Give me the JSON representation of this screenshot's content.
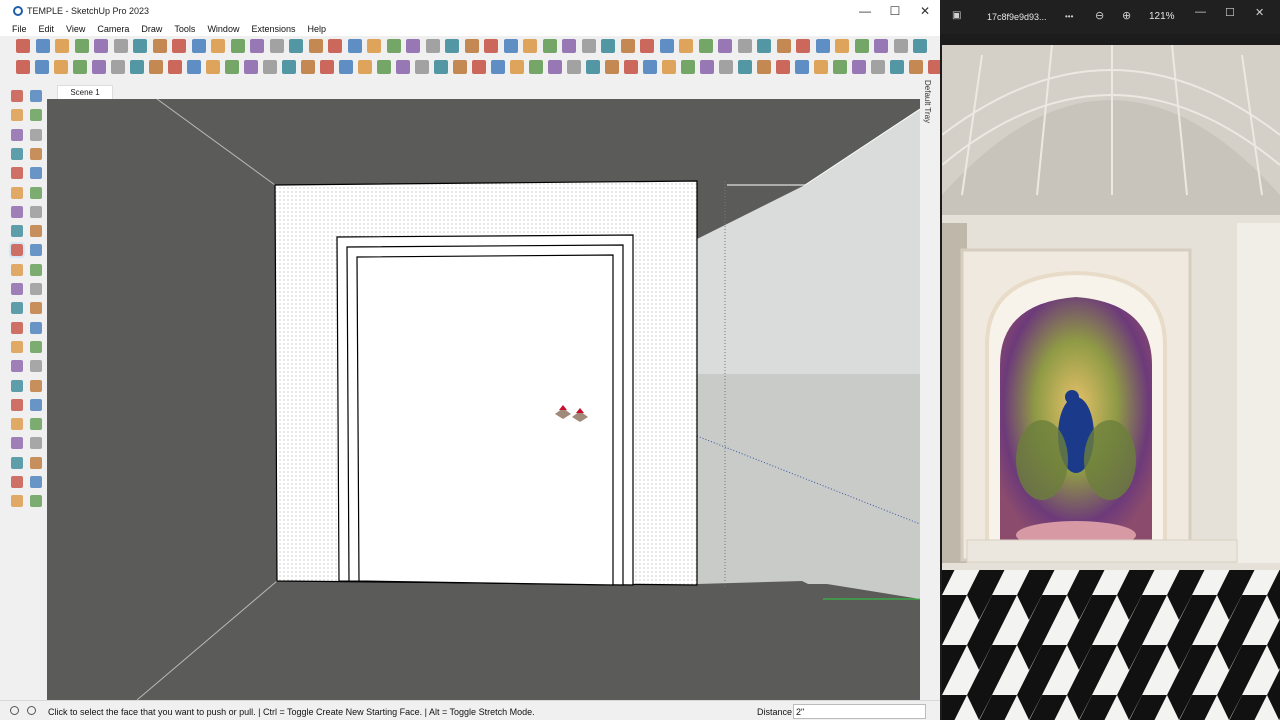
{
  "window": {
    "title": "TEMPLE - SketchUp Pro 2023",
    "minimize_glyph": "—",
    "maximize_glyph": "☐",
    "close_glyph": "✕"
  },
  "menu": [
    "File",
    "Edit",
    "View",
    "Camera",
    "Draw",
    "Tools",
    "Window",
    "Extensions",
    "Help"
  ],
  "scene_tab": "Scene 1",
  "tray_label": "Default Tray",
  "status": {
    "message": "Click to select the face that you want to push or pull. | Ctrl = Toggle Create New Starting Face. | Alt = Toggle Stretch Mode.",
    "distance_label": "Distance",
    "distance_value": "2\""
  },
  "viewer": {
    "file_name": "17c8f9e9d93...",
    "more_glyph": "•••",
    "zoom_out_glyph": "⊖",
    "zoom_in_glyph": "⊕",
    "zoom": "121%"
  },
  "colors": {
    "viewport_bg": "#5b5b59",
    "sky": "#d9dcdb",
    "ground": "#c9cbc8",
    "active_tool": "#cde3f7"
  }
}
